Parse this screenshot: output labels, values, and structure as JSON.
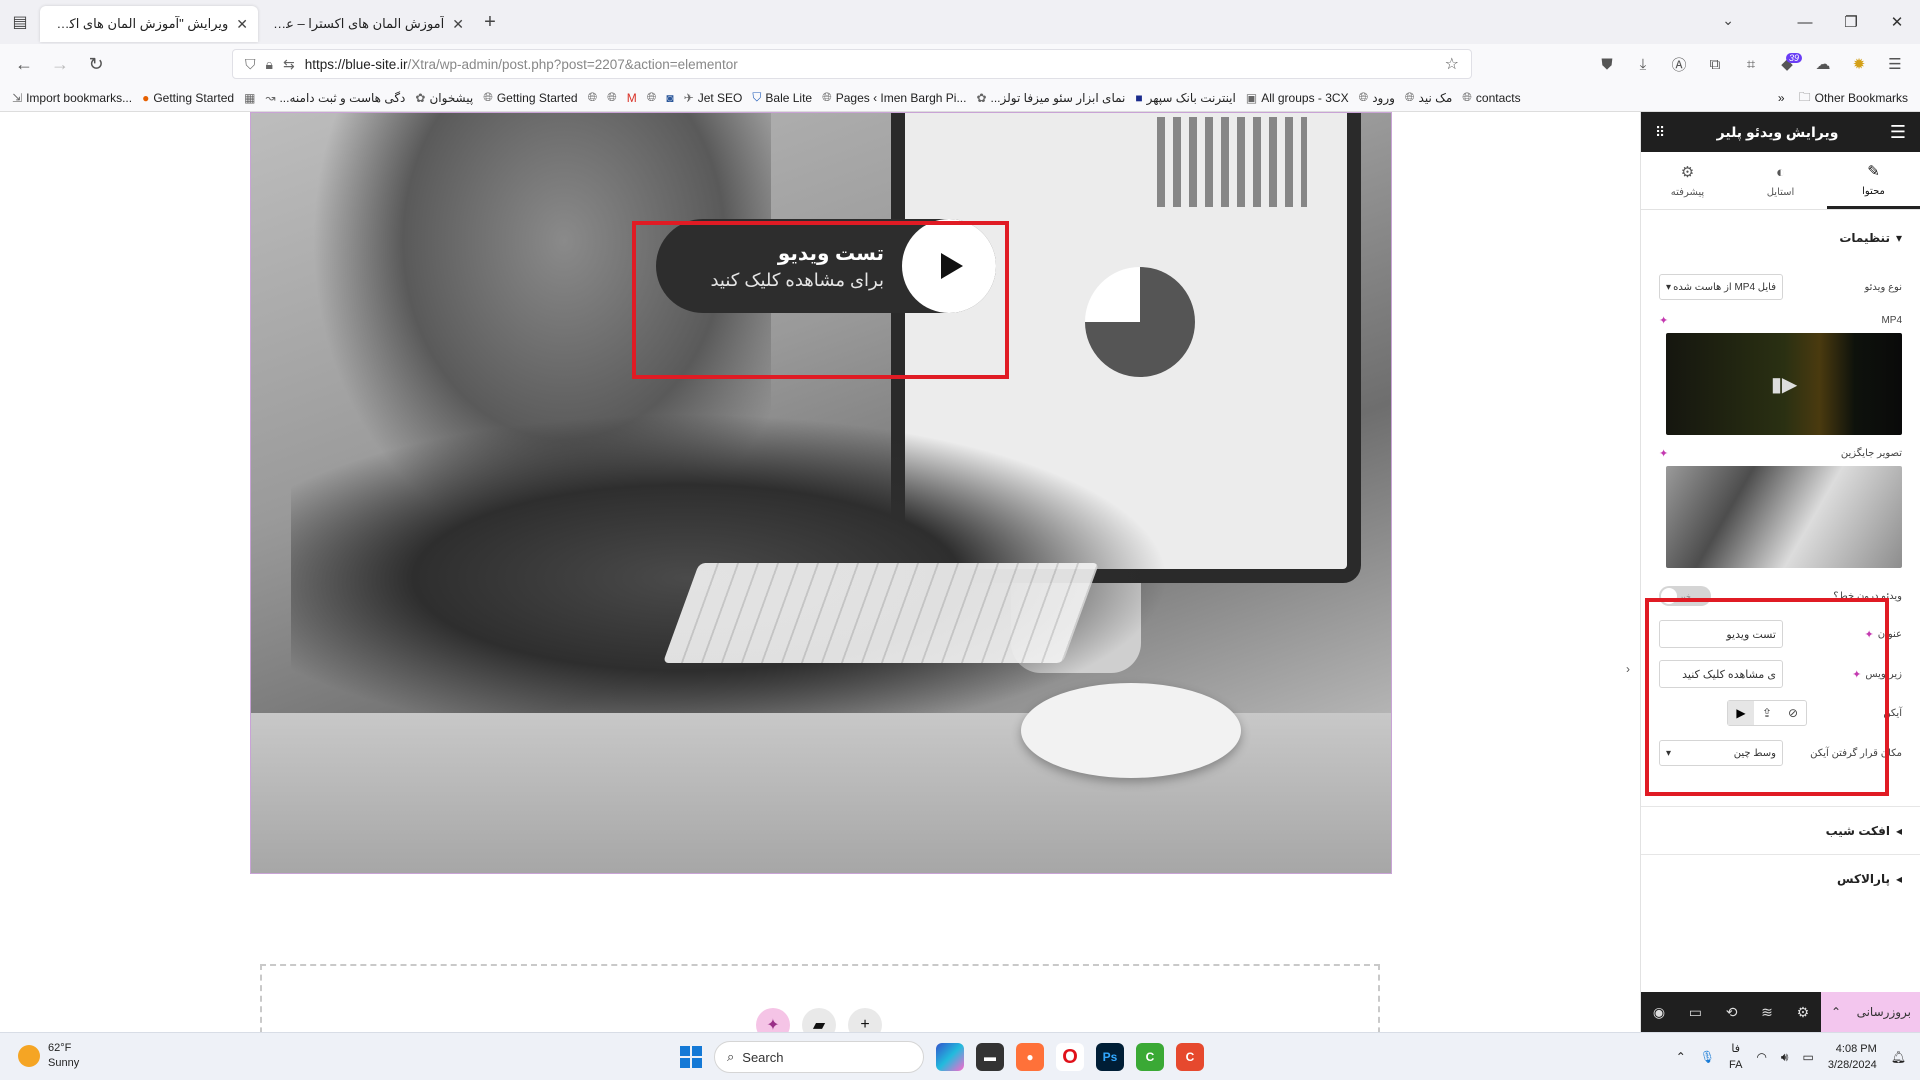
{
  "browser": {
    "tabs": [
      {
        "title": "ویرایش \"آموزش المان های اکسترا – علا",
        "active": true
      },
      {
        "title": "آموزش المان های اکسترا – علاءالدین",
        "active": false
      }
    ],
    "new_tab": "+",
    "url_host": "https://blue-site.ir",
    "url_path": "/Xtra/wp-admin/post.php?post=2207&action=elementor",
    "extension_badge": "39"
  },
  "bookmarks": {
    "left": [
      {
        "label": "Import bookmarks..."
      },
      {
        "label": "Getting Started"
      },
      {
        "label": "...دگی هاست و ثبت دامنه"
      },
      {
        "label": "پیشخوان"
      },
      {
        "label": "Getting Started"
      },
      {
        "label": "Jet SEO"
      },
      {
        "label": "Bale Lite"
      },
      {
        "label": "Pages ‹ Imen Bargh Pi..."
      },
      {
        "label": "...نمای ابزار سئو میزفا تولز"
      },
      {
        "label": "اینترنت بانک سپهر"
      },
      {
        "label": "All groups - 3CX"
      },
      {
        "label": "ورود"
      },
      {
        "label": "مک نید"
      },
      {
        "label": "contacts"
      }
    ],
    "other": "Other Bookmarks"
  },
  "video_widget": {
    "title": "تست ویدیو",
    "subtitle": "برای مشاهده کلیک کنید"
  },
  "panel": {
    "header_title": "ویرایش ویدئو پلیر",
    "tabs": [
      {
        "label": "محتوا",
        "icon": "pencil-icon"
      },
      {
        "label": "استایل",
        "icon": "contrast-icon"
      },
      {
        "label": "پیشرفته",
        "icon": "gear-icon"
      }
    ],
    "settings_section": "تنظیمات",
    "video_type_label": "نوع ویدئو",
    "video_type_value": "فایل MP4 از هاست شده",
    "mp4_label": "MP4",
    "placeholder_image_label": "تصویر جایگزین",
    "inline_video_label": "ویدئو درون خط؟",
    "inline_video_state": "خیر",
    "title_label": "عنوان",
    "title_value": "تست ویدیو",
    "subtitle_label": "زیرنویس",
    "subtitle_value": "ی مشاهده کلیک کنید",
    "icon_label": "آیکن",
    "icon_position_label": "مکان قرار گرفتن آیکن",
    "icon_position_value": "وسط چین",
    "tilt_section": "افکت شیب",
    "parallax_section": "پارالاکس",
    "update_button": "بروزرسانی"
  },
  "taskbar": {
    "temperature": "62°F",
    "condition": "Sunny",
    "search_placeholder": "Search",
    "language": "فا",
    "language_code": "FA",
    "time": "4:08 PM",
    "date": "3/28/2024"
  },
  "colors": {
    "highlight_box": "#e01b24",
    "ai_accent": "#c43ab0",
    "update_button_bg": "#f3c6ee",
    "panel_dark": "#1f1f1f"
  }
}
